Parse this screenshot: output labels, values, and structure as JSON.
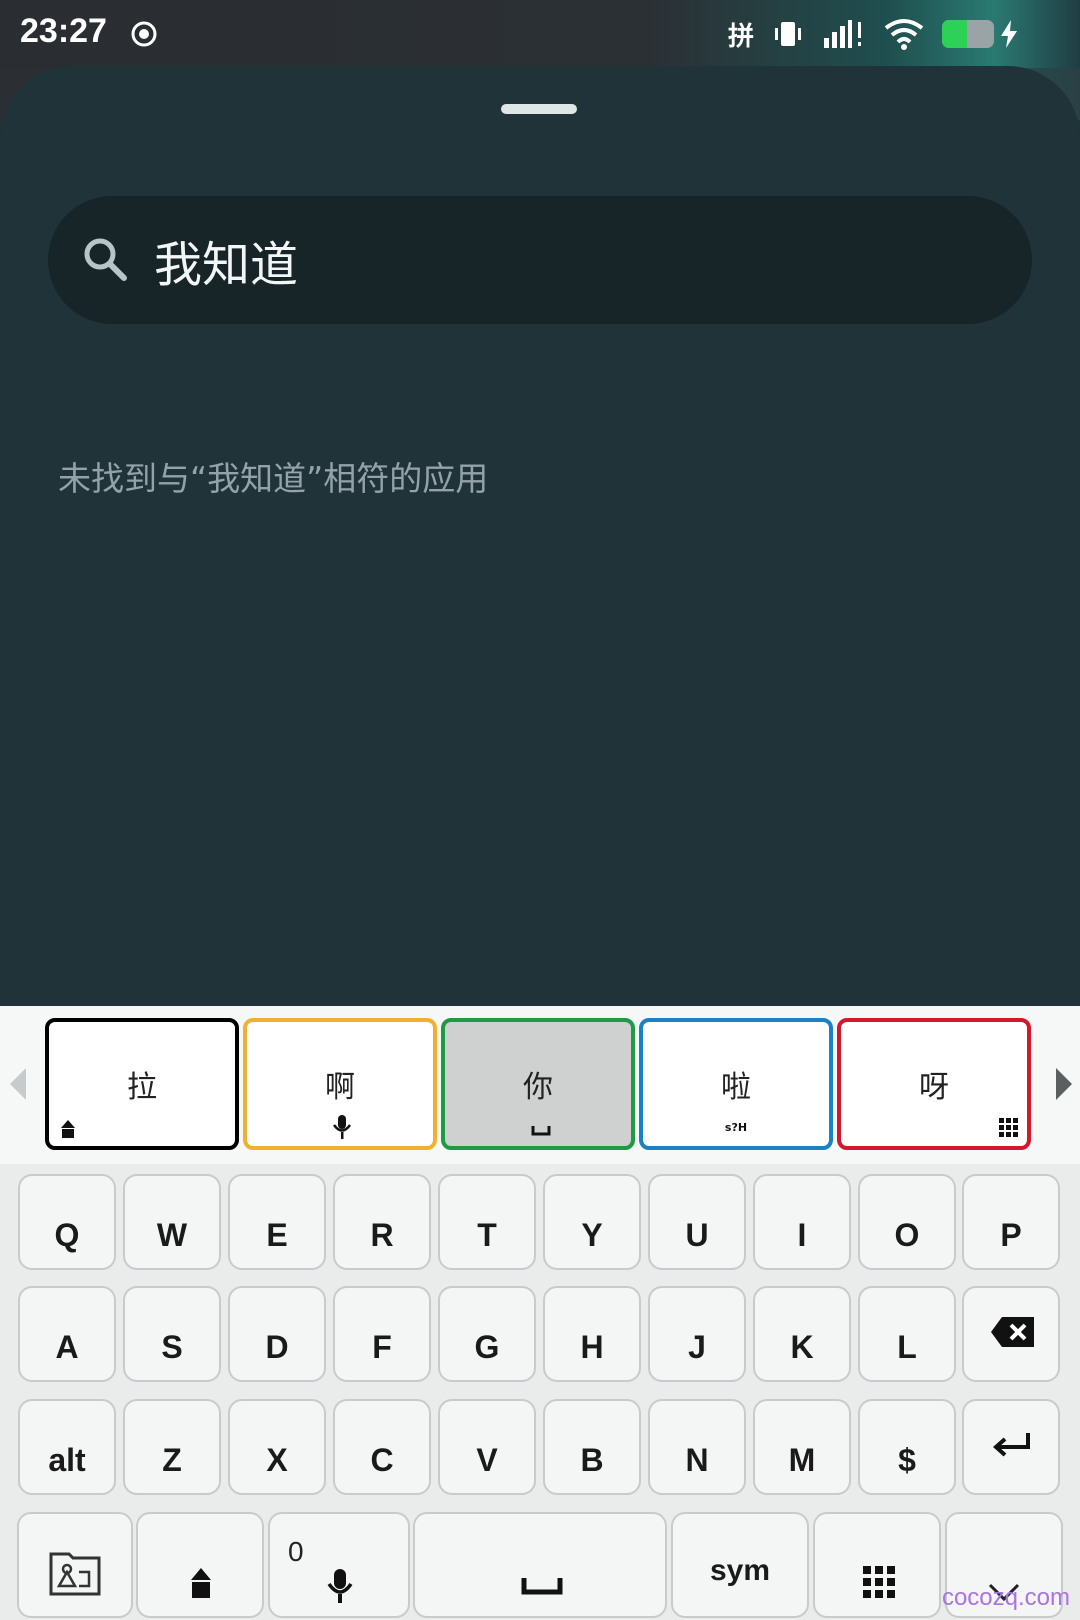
{
  "status_bar": {
    "time": "23:27",
    "ime_indicator": "拼",
    "battery_level": 0.48,
    "icons": [
      "record-icon",
      "vibrate-icon",
      "signal-icon",
      "wifi-icon",
      "battery-icon",
      "charging-icon"
    ]
  },
  "search": {
    "query": "我知道",
    "no_results_text": "未找到与“我知道”相符的应用"
  },
  "candidates": [
    {
      "text": "拉",
      "hint_icon": "shift-icon",
      "border": "#000000"
    },
    {
      "text": "啊",
      "hint_icon": "mic-icon",
      "border": "#f0b133"
    },
    {
      "text": "你",
      "hint_icon": "space-icon",
      "border": "#1f9a45"
    },
    {
      "text": "啦",
      "hint_text": "s?H",
      "border": "#1a82c4"
    },
    {
      "text": "呀",
      "hint_icon": "grid-icon",
      "border": "#d4172c"
    }
  ],
  "keyboard": {
    "row1": [
      "Q",
      "W",
      "E",
      "R",
      "T",
      "Y",
      "U",
      "I",
      "O",
      "P"
    ],
    "row2": [
      "A",
      "S",
      "D",
      "F",
      "G",
      "H",
      "J",
      "K",
      "L"
    ],
    "row3": [
      "alt",
      "Z",
      "X",
      "C",
      "V",
      "B",
      "N",
      "M",
      "$"
    ],
    "bottom": {
      "mic_hint": "0",
      "sym_label": "sym"
    },
    "colors": {
      "key_bg": "#f4f5f5",
      "key_border": "#c8cbcc",
      "selected_candidate_bg": "#cfd1d1"
    }
  },
  "watermark": "cocozq.com"
}
